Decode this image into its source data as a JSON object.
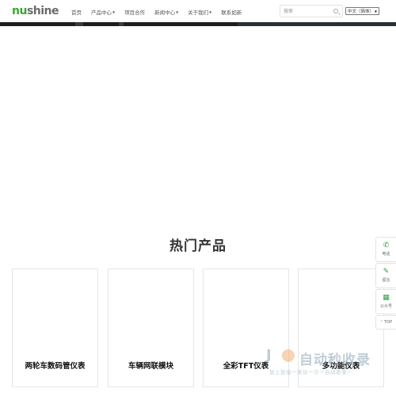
{
  "logo": {
    "nu": "nu",
    "rest": "shine"
  },
  "nav": [
    {
      "label": "首页",
      "dropdown": false
    },
    {
      "label": "产品中心",
      "dropdown": true
    },
    {
      "label": "项目合作",
      "dropdown": false
    },
    {
      "label": "新闻中心",
      "dropdown": true
    },
    {
      "label": "关于我们",
      "dropdown": true
    },
    {
      "label": "联系如新",
      "dropdown": false
    }
  ],
  "search": {
    "placeholder": "搜索"
  },
  "language": {
    "selected": "中文（简体）"
  },
  "hot_products": {
    "title": "热门产品",
    "items": [
      {
        "label": "两轮车数码管仪表"
      },
      {
        "label": "车辆网联模块"
      },
      {
        "label": "全彩TFT仪表"
      },
      {
        "label": "多功能仪表"
      }
    ]
  },
  "side_tools": [
    {
      "label": "电话",
      "icon": "phone-icon"
    },
    {
      "label": "留言",
      "icon": "pencil-icon"
    },
    {
      "label": "公众号",
      "icon": "qrcode-icon"
    },
    {
      "label": "TOP",
      "icon": "arrow-up-icon"
    }
  ],
  "watermark": {
    "big": "自动秒收录",
    "small": "放上链接一来访一次一自动收录一"
  },
  "colors": {
    "brand_green": "#3fa535",
    "tool_green": "#2e9e42",
    "dark_strip": "#1e1e1e"
  }
}
